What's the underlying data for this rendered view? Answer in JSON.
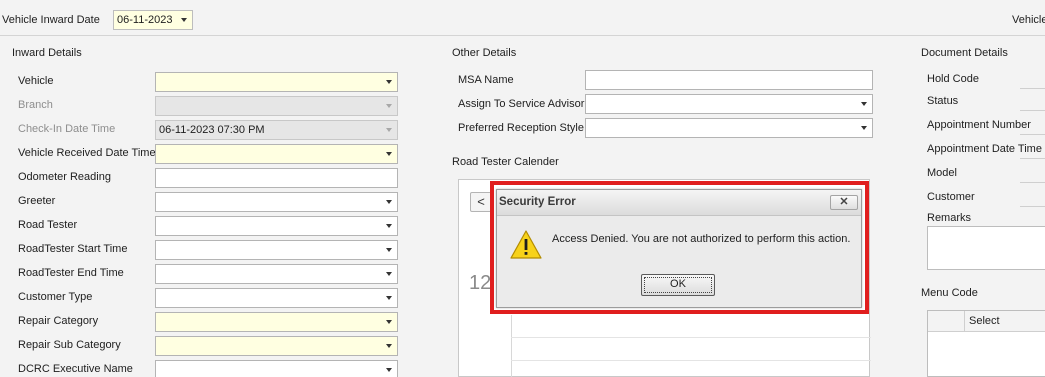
{
  "topbar": {
    "inward_date_label": "Vehicle Inward Date",
    "inward_date_value": "06-11-2023",
    "right_label": "Vehicle"
  },
  "inward": {
    "title": "Inward Details",
    "fields": [
      {
        "label": "Vehicle",
        "value": "",
        "kind": "dropdown",
        "style": "required"
      },
      {
        "label": "Branch",
        "value": "",
        "kind": "dropdown",
        "style": "disabled"
      },
      {
        "label": "Check-In Date Time",
        "value": "06-11-2023 07:30 PM",
        "kind": "dropdown",
        "style": "disabled"
      },
      {
        "label": "Vehicle Received Date  Time",
        "value": "",
        "kind": "dropdown",
        "style": "required"
      },
      {
        "label": "Odometer Reading",
        "value": "",
        "kind": "text",
        "style": "normal"
      },
      {
        "label": "Greeter",
        "value": "",
        "kind": "dropdown",
        "style": "normal"
      },
      {
        "label": "Road Tester",
        "value": "",
        "kind": "dropdown",
        "style": "normal"
      },
      {
        "label": "RoadTester Start Time",
        "value": "",
        "kind": "dropdown",
        "style": "normal"
      },
      {
        "label": "RoadTester End Time",
        "value": "",
        "kind": "dropdown",
        "style": "normal"
      },
      {
        "label": "Customer Type",
        "value": "",
        "kind": "dropdown",
        "style": "normal"
      },
      {
        "label": "Repair Category",
        "value": "",
        "kind": "dropdown",
        "style": "required"
      },
      {
        "label": "Repair Sub Category",
        "value": "",
        "kind": "dropdown",
        "style": "required"
      },
      {
        "label": "DCRC Executive Name",
        "value": "",
        "kind": "dropdown",
        "style": "normal"
      }
    ]
  },
  "other": {
    "title": "Other Details",
    "fields": [
      {
        "label": "MSA Name",
        "value": "",
        "kind": "text"
      },
      {
        "label": "Assign To Service Advisor",
        "value": "",
        "kind": "dropdown"
      },
      {
        "label": "Preferred Reception Style",
        "value": "",
        "kind": "dropdown"
      }
    ],
    "calendar_title": "Road Tester Calender",
    "calendar_prev": "<",
    "calendar_day": "12"
  },
  "document": {
    "title": "Document Details",
    "fields": [
      "Hold Code",
      "Status",
      "Appointment Number",
      "Appointment Date Time",
      "Model",
      "Customer",
      "Remarks"
    ],
    "menu_code_title": "Menu Code",
    "menu_grid_column": "Select"
  },
  "dialog": {
    "title": "Security Error",
    "close_label": "✕",
    "message": "Access Denied. You are not authorized to perform this action.",
    "ok_label": "OK",
    "icon": "warning-icon",
    "highlight_color": "#e01e1e"
  }
}
